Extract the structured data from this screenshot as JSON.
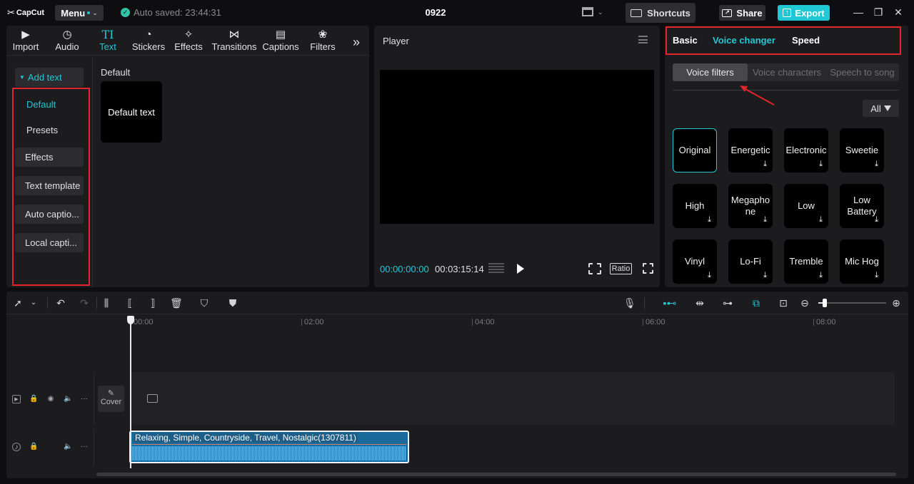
{
  "app": {
    "logo": "CapCut",
    "menu_label": "Menu",
    "autosave": "Auto saved: 23:44:31",
    "project_title": "0922",
    "shortcuts_label": "Shortcuts",
    "share_label": "Share",
    "export_label": "Export",
    "accent_color": "#1fc8d4"
  },
  "media_tabs": [
    {
      "label": "Import",
      "icon": "import-icon"
    },
    {
      "label": "Audio",
      "icon": "audio-icon"
    },
    {
      "label": "Text",
      "icon": "text-icon",
      "active": true
    },
    {
      "label": "Stickers",
      "icon": "stickers-icon"
    },
    {
      "label": "Effects",
      "icon": "effects-icon"
    },
    {
      "label": "Transitions",
      "icon": "transitions-icon"
    },
    {
      "label": "Captions",
      "icon": "captions-icon"
    },
    {
      "label": "Filters",
      "icon": "filters-icon"
    }
  ],
  "sidebar": {
    "items": [
      {
        "label": "Add text"
      },
      {
        "label": "Default"
      },
      {
        "label": "Presets"
      },
      {
        "label": "Effects"
      },
      {
        "label": "Text template"
      },
      {
        "label": "Auto captio..."
      },
      {
        "label": "Local capti..."
      }
    ]
  },
  "text_panel": {
    "section_title": "Default",
    "card_label": "Default text"
  },
  "player": {
    "title": "Player",
    "current_time": "00:00:00:00",
    "total_time": "00:03:15:14",
    "ratio_label": "Ratio"
  },
  "properties": {
    "tabs": [
      "Basic",
      "Voice changer",
      "Speed"
    ],
    "active_tab": "Voice changer",
    "subtabs": [
      "Voice filters",
      "Voice characters",
      "Speech to song"
    ],
    "filter_label": "All",
    "voices": [
      {
        "label": "Original",
        "selected": true
      },
      {
        "label": "Energetic"
      },
      {
        "label": "Electronic"
      },
      {
        "label": "Sweetie"
      },
      {
        "label": "High"
      },
      {
        "label": "Megapho ne"
      },
      {
        "label": "Low"
      },
      {
        "label": "Low Battery"
      },
      {
        "label": "Vinyl"
      },
      {
        "label": "Lo-Fi"
      },
      {
        "label": "Tremble"
      },
      {
        "label": "Mic Hog"
      }
    ]
  },
  "timeline": {
    "ruler": [
      "00:00",
      "02:00",
      "04:00",
      "06:00",
      "08:00"
    ],
    "cover_label": "Cover",
    "audio_clip_label": "Relaxing, Simple, Countryside, Travel, Nostalgic(1307811)"
  },
  "annotation_color": "#e2252b"
}
